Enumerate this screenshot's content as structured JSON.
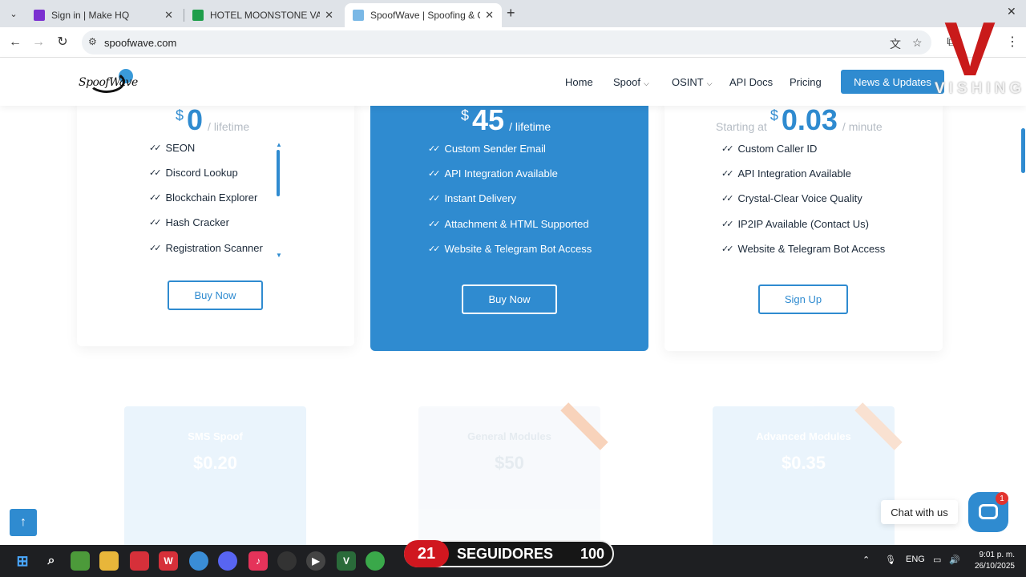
{
  "browser": {
    "tabs": [
      {
        "title": "Sign in | Make HQ",
        "active": false
      },
      {
        "title": "HOTEL MOONSTONE VALLEY LIS",
        "active": false
      },
      {
        "title": "SpoofWave | Spoofing & OSINT",
        "active": true
      }
    ],
    "url": "spoofwave.com"
  },
  "site": {
    "logo_text": "SpoofWave",
    "nav": [
      "Home",
      "Spoof",
      "OSINT",
      "API Docs",
      "Pricing"
    ],
    "cta": "News & Updates"
  },
  "overlay": {
    "brand_letter": "V",
    "brand_text": "VISHING"
  },
  "pricing": {
    "cards": [
      {
        "currency": "$",
        "amount": "0",
        "period": "/ lifetime",
        "prefix": "",
        "features": [
          "SEON",
          "Discord Lookup",
          "Blockchain Explorer",
          "Hash Cracker",
          "Registration Scanner"
        ],
        "button": "Buy Now"
      },
      {
        "currency": "$",
        "amount": "45",
        "period": "/ lifetime",
        "prefix": "",
        "features": [
          "Custom Sender Email",
          "API Integration Available",
          "Instant Delivery",
          "Attachment & HTML Supported",
          "Website & Telegram Bot Access"
        ],
        "button": "Buy Now"
      },
      {
        "currency": "$",
        "amount": "0.03",
        "period": "/ minute",
        "prefix": "Starting at",
        "features": [
          "Custom Caller ID",
          "API Integration Available",
          "Crystal-Clear Voice Quality",
          "IP2IP Available (Contact Us)",
          "Website & Telegram Bot Access"
        ],
        "button": "Sign Up"
      }
    ],
    "faded_cards": [
      {
        "title": "SMS Spoof",
        "price": "$0.20"
      },
      {
        "title": "General Modules",
        "price": "$50"
      },
      {
        "title": "Advanced Modules",
        "price": "$0.35"
      }
    ]
  },
  "chat": {
    "label": "Chat with us",
    "badge": "1"
  },
  "stream": {
    "count": "21",
    "label": "SEGUIDORES",
    "goal": "100"
  },
  "taskbar": {
    "lang": "ENG",
    "time": "9:01 p. m.",
    "date": "26/10/2025"
  },
  "colors": {
    "accent": "#2f8bd0",
    "brand_red": "#c91a1a"
  }
}
